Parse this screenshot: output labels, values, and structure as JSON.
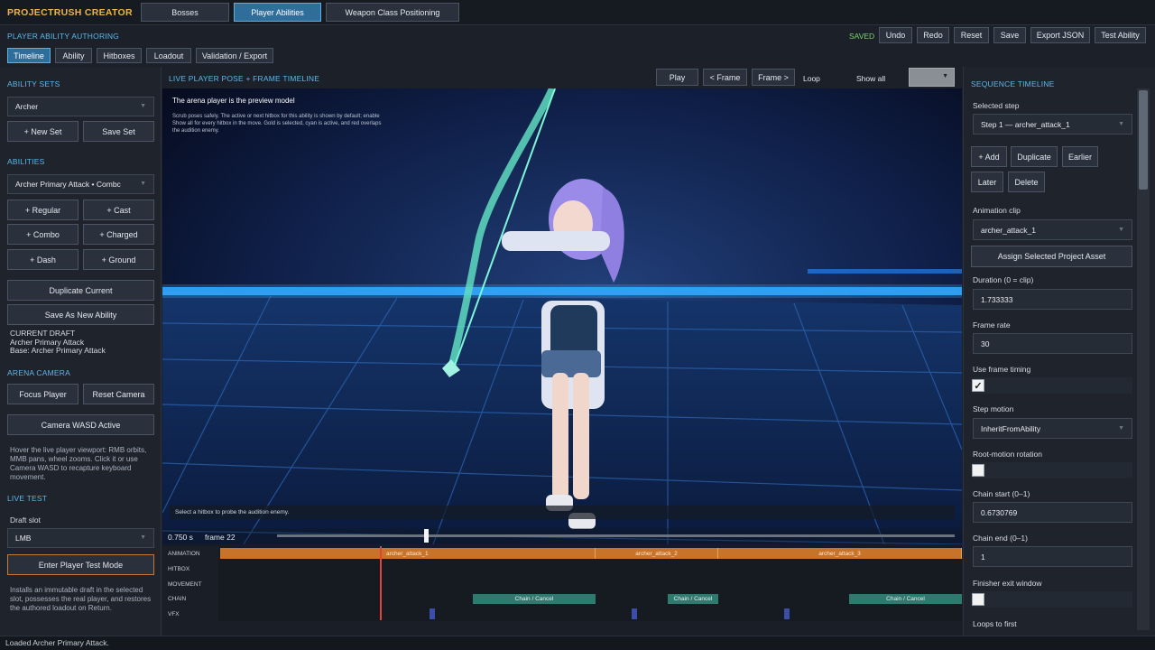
{
  "app": {
    "title": "PROJECTRUSH CREATOR"
  },
  "top_tabs": [
    {
      "label": "Bosses",
      "active": false
    },
    {
      "label": "Player Abilities",
      "active": true
    },
    {
      "label": "Weapon Class Positioning",
      "active": false
    }
  ],
  "toolbar": {
    "section_title": "PLAYER ABILITY AUTHORING",
    "status": "SAVED",
    "undo": "Undo",
    "redo": "Redo",
    "reset": "Reset",
    "save": "Save",
    "export_json": "Export JSON",
    "test_ability": "Test Ability"
  },
  "sub_tabs": [
    {
      "label": "Timeline",
      "active": true
    },
    {
      "label": "Ability",
      "active": false
    },
    {
      "label": "Hitboxes",
      "active": false
    },
    {
      "label": "Loadout",
      "active": false
    },
    {
      "label": "Validation / Export",
      "active": false
    }
  ],
  "left": {
    "ability_sets": {
      "title": "ABILITY SETS",
      "selected": "Archer",
      "new_set": "+ New Set",
      "save_set": "Save Set"
    },
    "abilities": {
      "title": "ABILITIES",
      "selected": "Archer Primary Attack  •  Combc",
      "add_buttons": [
        "+ Regular",
        "+ Cast",
        "+ Combo",
        "+ Charged",
        "+ Dash",
        "+ Ground"
      ],
      "duplicate": "Duplicate Current",
      "save_as_new": "Save As New Ability",
      "draft_lines": [
        "CURRENT DRAFT",
        "Archer Primary Attack",
        "Base: Archer Primary Attack"
      ]
    },
    "arena_camera": {
      "title": "ARENA CAMERA",
      "focus_player": "Focus Player",
      "reset_camera": "Reset Camera",
      "wasd": "Camera WASD Active",
      "hint": "Hover the live player viewport: RMB orbits, MMB pans, wheel zooms. Click it or use Camera WASD to recapture keyboard movement."
    },
    "live_test": {
      "title": "LIVE TEST",
      "draft_slot_label": "Draft slot",
      "draft_slot_value": "LMB",
      "enter_test": "Enter Player Test Mode",
      "hint": "Installs an immutable draft in the selected slot, possesses the real player, and restores the authored loadout on Return."
    }
  },
  "viewport": {
    "title": "LIVE PLAYER POSE + FRAME TIMELINE",
    "play": "Play",
    "prev_frame": "< Frame",
    "next_frame": "Frame >",
    "loop": "Loop",
    "show_all": "Show all",
    "show_all_value": "",
    "overlay_title": "The arena player is the preview model",
    "overlay_text": "Scrub poses safely. The active or next hitbox for this ability is shown by default; enable Show all for every hitbox in the move. Gold is selected, cyan is active, and red overlaps the audition enemy.",
    "probe_hint": "Select a hitbox to probe the audition enemy.",
    "time_readout": "0.750 s",
    "frame_readout": "frame 22",
    "scrub_fraction": 0.22
  },
  "timeline": {
    "rows": [
      "ANIMATION",
      "HITBOX",
      "MOVEMENT",
      "CHAIN",
      "VFX"
    ],
    "animation_clips": [
      "archer_attack_1",
      "archer_attack_2",
      "archer_attack_3"
    ],
    "chain_label": "Chain / Cancel"
  },
  "right": {
    "title": "SEQUENCE TIMELINE",
    "selected_step_label": "Selected step",
    "selected_step_value": "Step 1 — archer_attack_1",
    "add": "+ Add",
    "duplicate": "Duplicate",
    "earlier": "Earlier",
    "later": "Later",
    "delete": "Delete",
    "animation_clip_label": "Animation clip",
    "animation_clip_value": "archer_attack_1",
    "assign_asset": "Assign Selected Project Asset",
    "duration_label": "Duration (0 = clip)",
    "duration_value": "1.733333",
    "frame_rate_label": "Frame rate",
    "frame_rate_value": "30",
    "use_frame_timing_label": "Use frame timing",
    "use_frame_timing": true,
    "step_motion_label": "Step motion",
    "step_motion_value": "InheritFromAbility",
    "root_motion_label": "Root-motion rotation",
    "root_motion": false,
    "chain_start_label": "Chain start (0–1)",
    "chain_start_value": "0.6730769",
    "chain_end_label": "Chain end (0–1)",
    "chain_end_value": "1",
    "finisher_label": "Finisher exit window",
    "finisher": false,
    "loops_label": "Loops to first"
  },
  "status_bar": {
    "message": "Loaded Archer Primary Attack."
  },
  "colors": {
    "accent": "#5cb8ea",
    "saved": "#7dd36f",
    "anim": "#c8732a",
    "chain": "#2f7a6f",
    "playhead": "#e0443a"
  }
}
